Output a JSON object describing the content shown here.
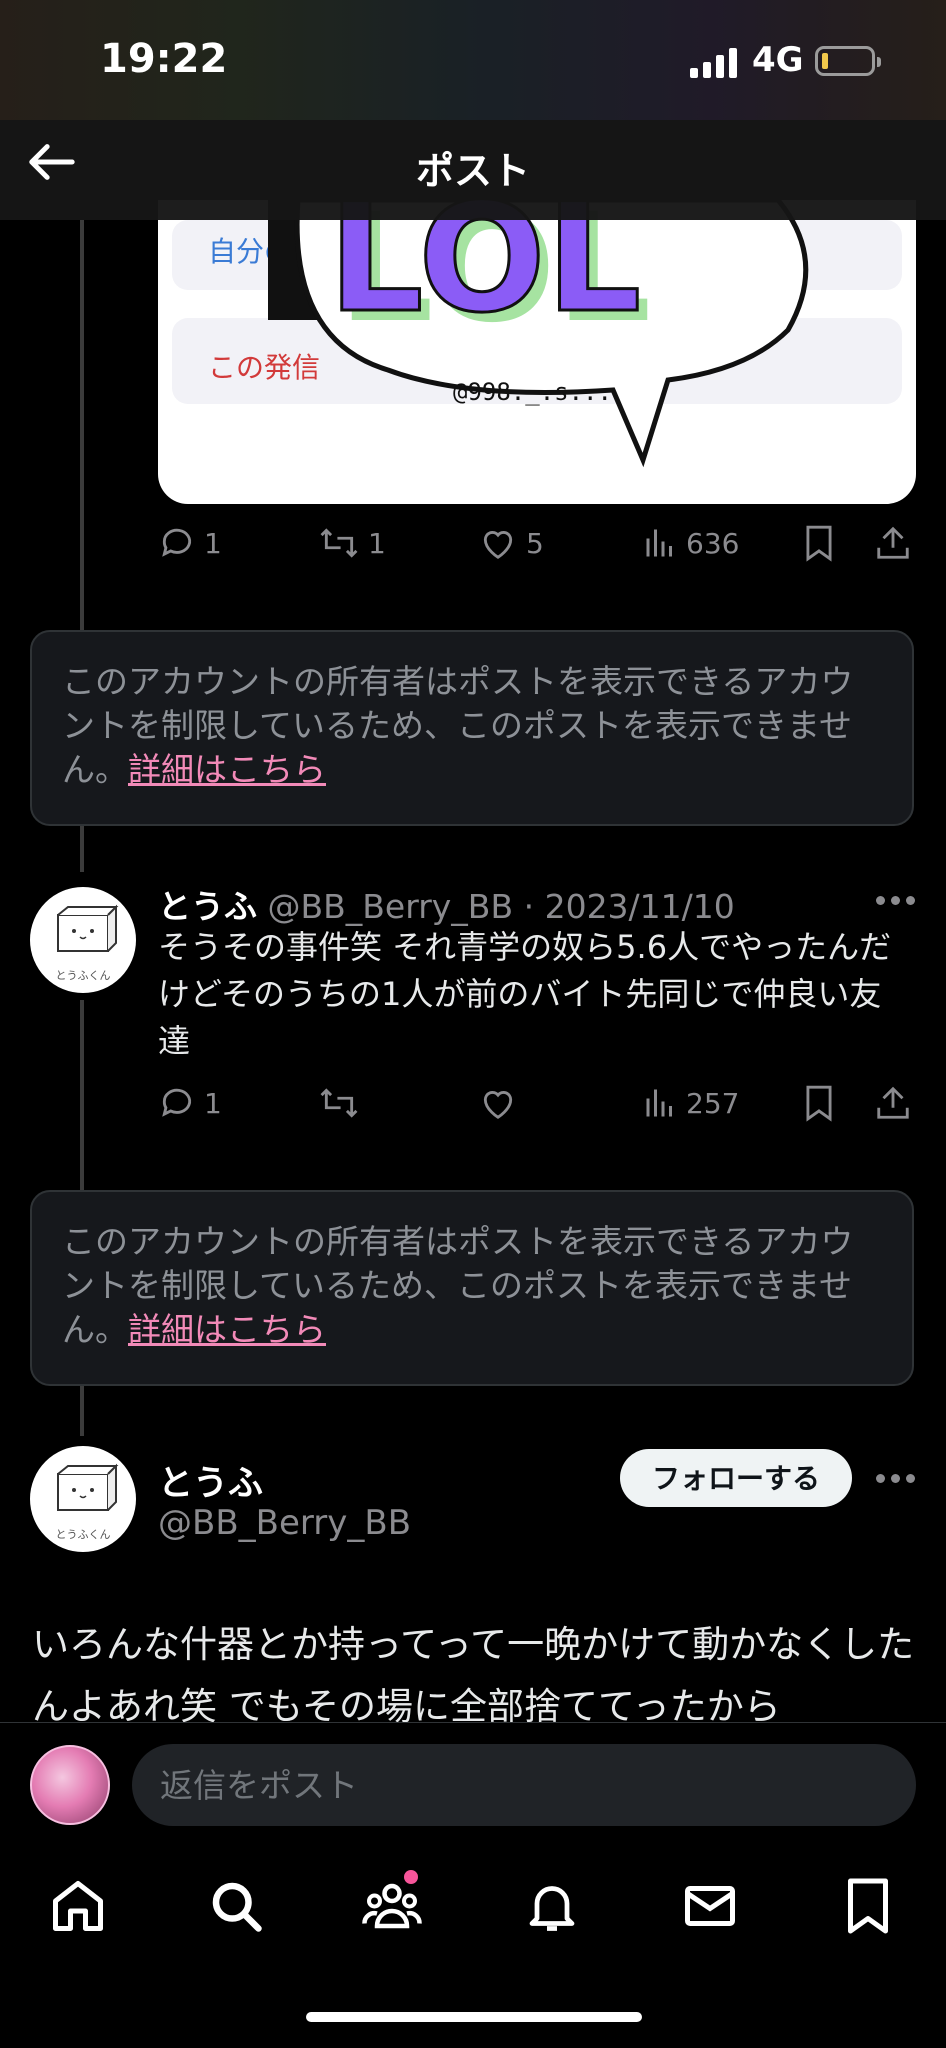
{
  "status_bar": {
    "time": "19:22",
    "network": "4G"
  },
  "nav": {
    "title": "ポスト"
  },
  "media_card": {
    "self_text": "自分の",
    "warn_text": "この発信",
    "sticker_text": "LOL",
    "sticker_handle": "@998._.s..."
  },
  "post1_actions": {
    "replies": "1",
    "reposts": "1",
    "likes": "5",
    "views": "636"
  },
  "notice1": {
    "text": "このアカウントの所有者はポストを表示できるアカウントを制限しているため、このポストを表示できません。",
    "link": "詳細はこちら"
  },
  "reply_tweet": {
    "name": "とうふ",
    "handle": "@BB_Berry_BB",
    "date": "· 2023/11/10",
    "text": "そうその事件笑 それ青学の奴ら5.6人でやったんだけどそのうちの1人が前のバイト先同じで仲良い友達",
    "avatar_label": "とうふくん",
    "actions": {
      "replies": "1",
      "reposts": "",
      "likes": "",
      "views": "257"
    }
  },
  "notice2": {
    "text": "このアカウントの所有者はポストを表示できるアカウントを制限しているため、このポストを表示できません。",
    "link": "詳細はこちら"
  },
  "main_tweet": {
    "name": "とうふ",
    "handle": "@BB_Berry_BB",
    "follow_label": "フォローする",
    "avatar_label": "とうふくん",
    "text": "いろんな什器とか持ってって一晩かけて動かなくしたんよあれ笑 でもその場に全部捨ててったから"
  },
  "reply_bar": {
    "placeholder": "返信をポスト"
  },
  "tabs": [
    {
      "icon": "home-icon"
    },
    {
      "icon": "search-icon"
    },
    {
      "icon": "communities-icon"
    },
    {
      "icon": "bell-icon"
    },
    {
      "icon": "mail-icon"
    },
    {
      "icon": "bookmark-icon"
    }
  ],
  "colors": {
    "link_pink": "#f28ab8",
    "notification_dot": "#f7559a"
  }
}
